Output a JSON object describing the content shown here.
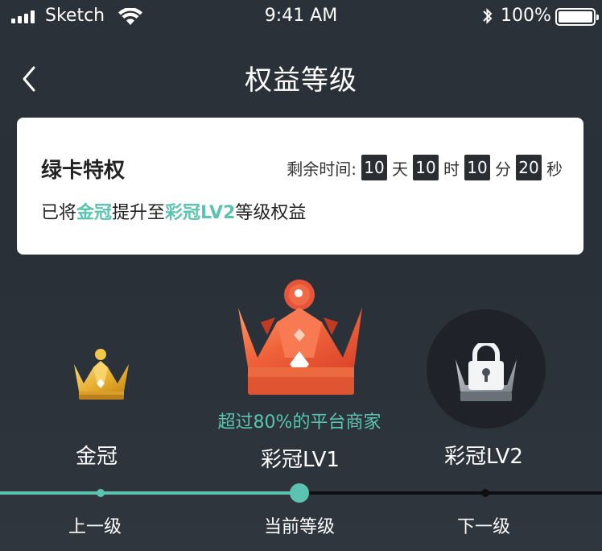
{
  "status_bar": {
    "carrier": "Sketch",
    "time": "9:41 AM",
    "battery": "100%"
  },
  "nav": {
    "title": "权益等级",
    "back_icon": "chevron-left-icon"
  },
  "card": {
    "title": "绿卡特权",
    "countdown": {
      "label": "剩余时间:",
      "days": "10",
      "days_unit": "天",
      "hours": "10",
      "hours_unit": "时",
      "minutes": "10",
      "minutes_unit": "分",
      "seconds": "20",
      "seconds_unit": "秒"
    },
    "desc": {
      "prefix": "已将",
      "from": "金冠",
      "middle": "提升至",
      "to": "彩冠LV2",
      "suffix": "等级权益"
    }
  },
  "levels": {
    "previous": {
      "name": "金冠",
      "icon": "gold-crown-icon"
    },
    "current": {
      "name": "彩冠LV1",
      "icon": "red-crown-icon",
      "stat": "超过80%的平台商家"
    },
    "next": {
      "name": "彩冠LV2",
      "icon": "locked-crown-icon"
    }
  },
  "progress": {
    "previous_label": "上一级",
    "current_label": "当前等级",
    "next_label": "下一级"
  },
  "colors": {
    "accent": "#5bc3b0",
    "background": "#2c323a",
    "track_inactive": "#0d0f12"
  }
}
